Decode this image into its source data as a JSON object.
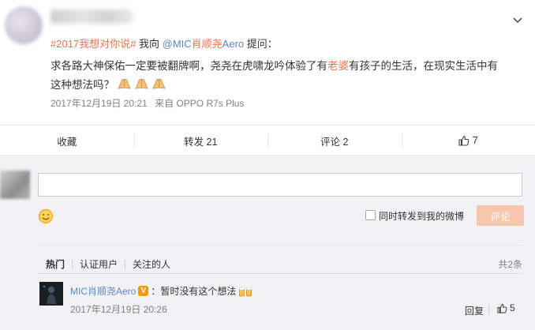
{
  "post": {
    "topic": "#2017我想对你说#",
    "ask_prefix": " 我向 ",
    "mention_at": "@MIC",
    "mention_name": "肖顺尧",
    "mention_suffix": "Aero",
    "ask_suffix": " 提问：",
    "body_line1_a": "求各路大神保佑一定要被翻牌啊，尧尧在虎啸龙吟体验了有",
    "body_line1_hl": "老婆",
    "body_line1_b": "有孩子的生活，在现实生活中有",
    "body_line2": "这种想法吗？",
    "emojis": [
      "palm-icon",
      "palm-icon",
      "palm-icon"
    ],
    "time": "2017年12月19日 20:21",
    "source": "来自 OPPO R7s Plus"
  },
  "actions": {
    "favorite": "收藏",
    "repost": "转发 21",
    "comment": "评论 2",
    "like_count": "7"
  },
  "composer": {
    "repost_checkbox_label": "同时转发到我的微博",
    "submit_label": "评论",
    "submit_color": "#f7c6ad"
  },
  "comment_tabs": {
    "hot": "热门",
    "verified": "认证用户",
    "following": "关注的人",
    "total": "共2条"
  },
  "comments": [
    {
      "user": "MIC肖顺尧Aero",
      "text": "：暂时没有这个想法",
      "time": "2017年12月19日 20:26",
      "reply_label": "回复",
      "likes": "5"
    }
  ],
  "colors": {
    "accent_orange": "#eb7350",
    "link_blue": "#5a88c8",
    "badge_orange": "#f59a00"
  }
}
